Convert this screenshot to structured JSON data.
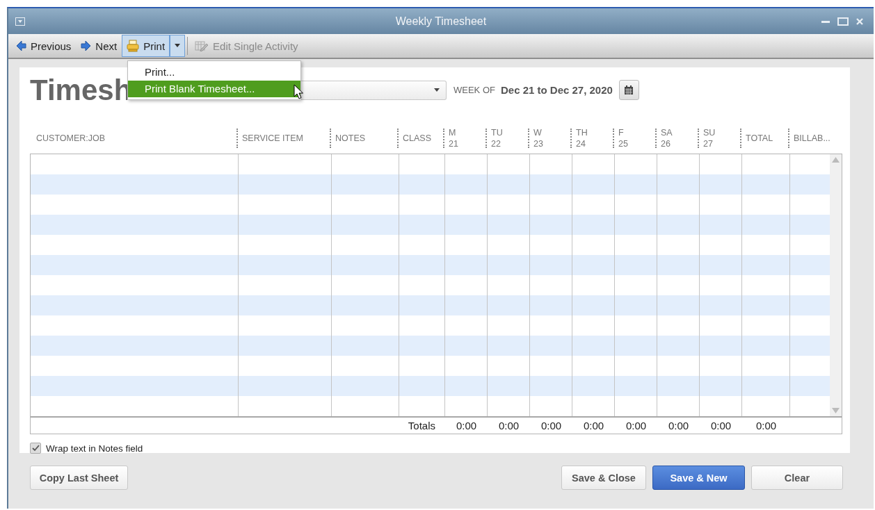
{
  "window": {
    "title": "Weekly Timesheet"
  },
  "toolbar": [
    {
      "kind": "back",
      "label": "Previous",
      "selected": false,
      "disabled": false
    },
    {
      "kind": "forward",
      "label": "Next",
      "selected": false,
      "disabled": false
    },
    {
      "kind": "print",
      "label": "Print",
      "selected": true,
      "disabled": false
    },
    {
      "kind": "edit",
      "label": "Edit Single Activity",
      "selected": false,
      "disabled": true
    }
  ],
  "print_menu": [
    {
      "label": "Print...",
      "selected": false
    },
    {
      "label": "Print Blank Timesheet...",
      "selected": true
    }
  ],
  "header": {
    "title": "Timesh",
    "week_label": "WEEK OF",
    "week_range": "Dec 21 to Dec 27, 2020"
  },
  "columns": [
    {
      "label": "CUSTOMER:JOB"
    },
    {
      "label": "SERVICE ITEM"
    },
    {
      "label": "NOTES"
    },
    {
      "label": "CLASS"
    },
    {
      "label": "M",
      "day": "21"
    },
    {
      "label": "TU",
      "day": "22"
    },
    {
      "label": "W",
      "day": "23"
    },
    {
      "label": "TH",
      "day": "24"
    },
    {
      "label": "F",
      "day": "25"
    },
    {
      "label": "SA",
      "day": "26"
    },
    {
      "label": "SU",
      "day": "27"
    },
    {
      "label": "TOTAL"
    },
    {
      "label": "BILLAB..."
    }
  ],
  "totals": {
    "label": "Totals",
    "values": [
      "0:00",
      "0:00",
      "0:00",
      "0:00",
      "0:00",
      "0:00",
      "0:00",
      "0:00"
    ]
  },
  "wrap_notes": {
    "label": "Wrap text in Notes field",
    "checked": true
  },
  "buttons": [
    {
      "label": "Copy Last Sheet",
      "kind": "default"
    },
    {
      "label": "Save & Close",
      "kind": "default"
    },
    {
      "label": "Save & New",
      "kind": "primary"
    },
    {
      "label": "Clear",
      "kind": "default"
    }
  ]
}
